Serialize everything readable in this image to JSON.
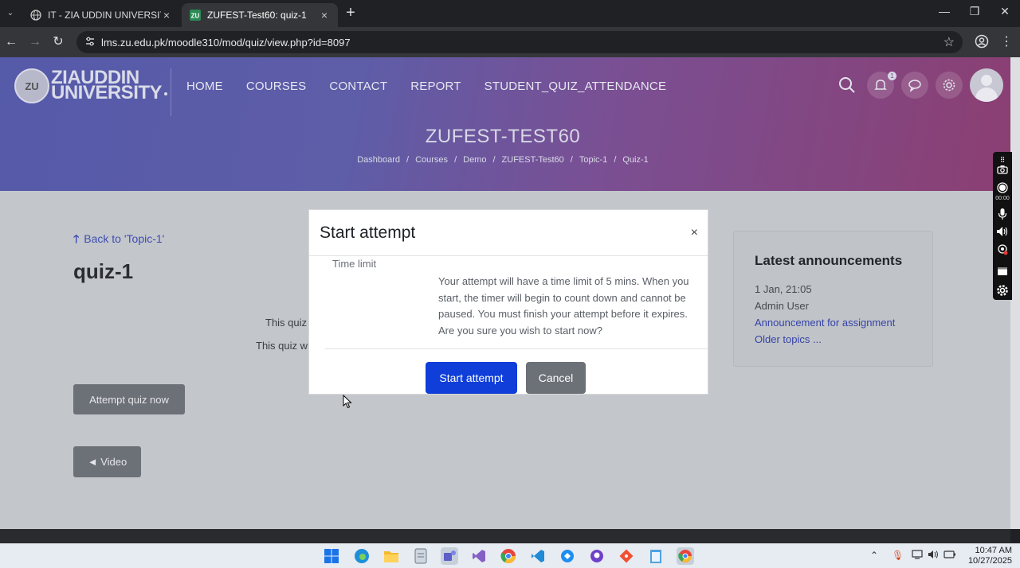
{
  "browser": {
    "tabs": [
      {
        "title": "IT - ZIA UDDIN UNIVERSITY",
        "favicon": "globe-icon",
        "active": false
      },
      {
        "title": "ZUFEST-Test60: quiz-1",
        "favicon": "zu-favicon",
        "active": true
      }
    ],
    "url": "lms.zu.edu.pk/moodle310/mod/quiz/view.php?id=8097"
  },
  "site": {
    "logo_text": "ZIAUDDIN UNIVERSITY",
    "nav": [
      "HOME",
      "COURSES",
      "CONTACT",
      "REPORT",
      "STUDENT_QUIZ_ATTENDANCE"
    ],
    "notification_count": "1",
    "course_title": "ZUFEST-TEST60",
    "breadcrumb": [
      "Dashboard",
      "Courses",
      "Demo",
      "ZUFEST-Test60",
      "Topic-1",
      "Quiz-1"
    ]
  },
  "recorder": {
    "time": "00:00"
  },
  "content": {
    "back_link": "Back to 'Topic-1'",
    "quiz_title": "quiz-1",
    "info1": "This quiz",
    "info2": "This quiz w",
    "attempt_button": "Attempt quiz now",
    "video_button": "◄ Video"
  },
  "announcements": {
    "title": "Latest announcements",
    "date": "1 Jan, 21:05",
    "author": "Admin User",
    "item": "Announcement for assignment",
    "older": "Older topics ..."
  },
  "modal": {
    "title": "Start attempt",
    "close": "×",
    "label": "Time limit",
    "text": "Your attempt will have a time limit of 5 mins. When you start, the timer will begin to count down and cannot be paused. You must finish your attempt before it expires. Are you sure you wish to start now?",
    "start_label": "Start attempt",
    "cancel_label": "Cancel"
  },
  "taskbar": {
    "time": "10:47 AM",
    "date": "10/27/2025"
  },
  "colors": {
    "primary_button": "#0f3ed8",
    "secondary_button": "#6c7077",
    "link": "#3542a8"
  }
}
